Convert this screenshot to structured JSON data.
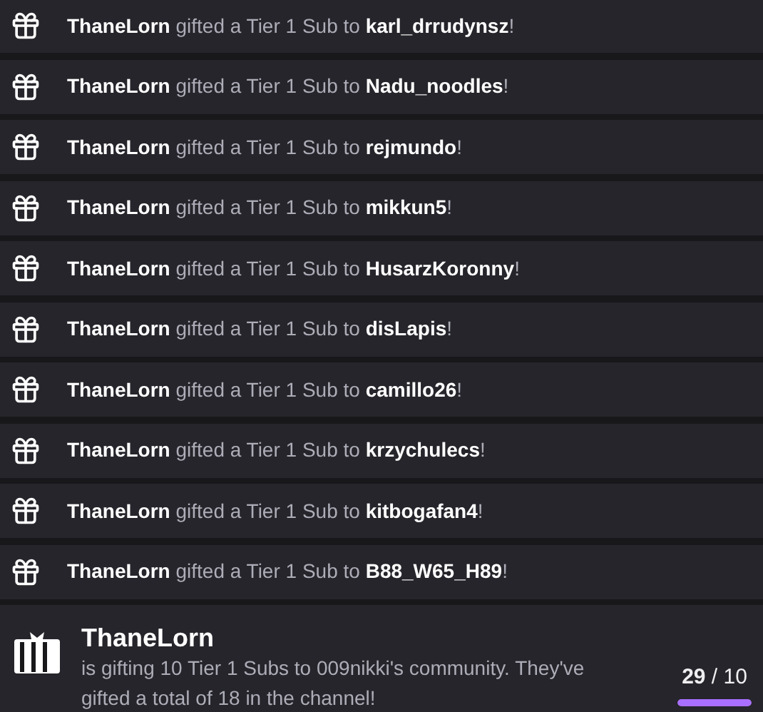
{
  "events": [
    {
      "message": "**ThaneLorn** gifted a Tier 1 Sub to **karl_drrudynsz**!"
    },
    {
      "message": "**ThaneLorn** gifted a Tier 1 Sub to **Nadu_noodles**!"
    },
    {
      "message": "**ThaneLorn** gifted a Tier 1 Sub to **rejmundo**!"
    },
    {
      "message": "**ThaneLorn** gifted a Tier 1 Sub to **mikkun5**!"
    },
    {
      "message": "**ThaneLorn** gifted a Tier 1 Sub to **HusarzKoronny**!"
    },
    {
      "message": "**ThaneLorn** gifted a Tier 1 Sub to **disLapis**!"
    },
    {
      "message": "**ThaneLorn** gifted a Tier 1 Sub to **camillo26**!"
    },
    {
      "message": "**ThaneLorn** gifted a Tier 1 Sub to **krzychulecs**!"
    },
    {
      "message": "**ThaneLorn** gifted a Tier 1 Sub to **kitbogafan4**!"
    },
    {
      "message": "**ThaneLorn** gifted a Tier 1 Sub to **B88_W65_H89**!"
    }
  ],
  "gift_banner": {
    "username": "ThaneLorn",
    "text": "is gifting 10 Tier 1 Subs to 009nikki's community. They've gifted a total of 18 in the channel!",
    "count": "**29** / 10",
    "level": 1
  }
}
